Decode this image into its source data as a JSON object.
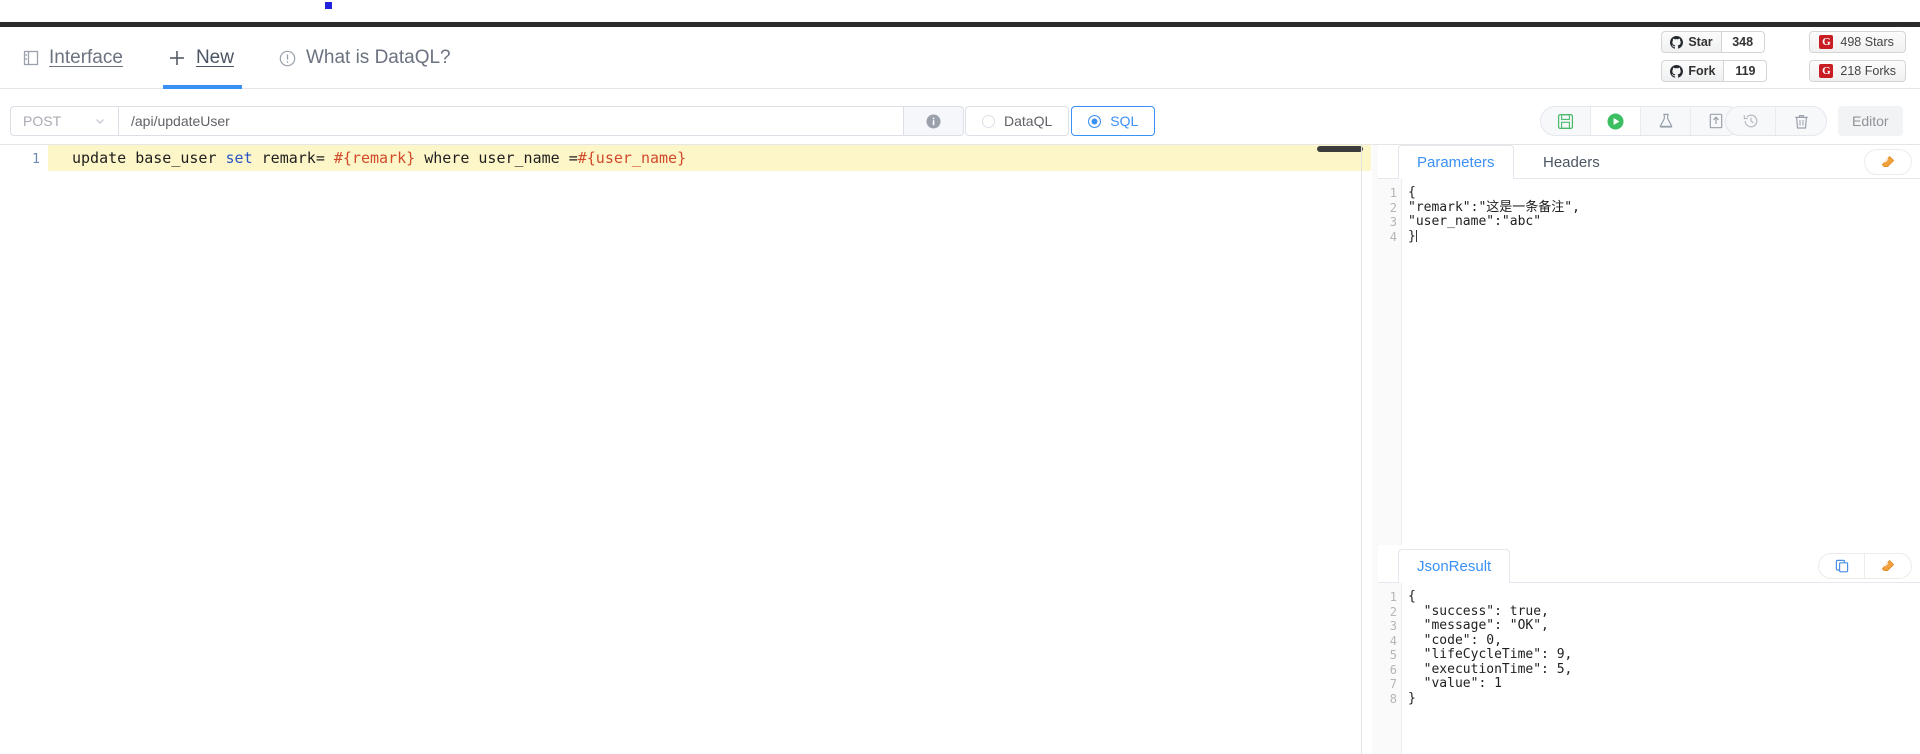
{
  "header": {
    "nav": [
      {
        "id": "interface",
        "icon": "book-icon",
        "label": "Interface"
      },
      {
        "id": "new",
        "icon": "plus-icon",
        "label": "New"
      },
      {
        "id": "what-is-dataql",
        "icon": "info-circle-icon",
        "label": "What is DataQL?"
      }
    ],
    "badges": {
      "github": [
        {
          "icon": "github-mark-icon",
          "label": "Star",
          "count": "348"
        },
        {
          "icon": "github-mark-icon",
          "label": "Fork",
          "count": "119"
        }
      ],
      "gitee": [
        {
          "icon": "gitee-logo-icon",
          "mark": "G",
          "label": "498 Stars"
        },
        {
          "icon": "gitee-logo-icon",
          "mark": "G",
          "label": "218 Forks"
        }
      ]
    }
  },
  "toolbar": {
    "method": "POST",
    "method_caret": "chevron-down-icon",
    "path_value": "/api/updateUser",
    "path_placeholder": "/api/path",
    "info_icon": "info-icon",
    "languages": [
      {
        "id": "dataql",
        "label": "DataQL",
        "selected": false
      },
      {
        "id": "sql",
        "label": "SQL",
        "selected": true
      }
    ],
    "actions_left": [
      {
        "id": "save",
        "icon": "save-icon",
        "title": "Save"
      },
      {
        "id": "run",
        "icon": "run-icon",
        "title": "Run"
      },
      {
        "id": "test",
        "icon": "flask-icon",
        "title": "Test"
      },
      {
        "id": "publish",
        "icon": "upload-icon",
        "title": "Publish"
      }
    ],
    "actions_right": [
      {
        "id": "history",
        "icon": "history-icon",
        "title": "History"
      },
      {
        "id": "delete",
        "icon": "trash-icon",
        "title": "Delete"
      }
    ],
    "editor_label": "Editor"
  },
  "sql_editor": {
    "line_number": "1",
    "tokens": [
      {
        "t": "update base_user ",
        "k": "plain"
      },
      {
        "t": "set",
        "k": "kw"
      },
      {
        "t": " remark= ",
        "k": "plain"
      },
      {
        "t": "#{remark}",
        "k": "var"
      },
      {
        "t": " where user_name =",
        "k": "plain"
      },
      {
        "t": "#{user_name}",
        "k": "var"
      }
    ],
    "plain_text": "update base_user set remark= #{remark} where user_name =#{user_name}"
  },
  "params_panel": {
    "tabs": [
      {
        "id": "parameters",
        "label": "Parameters",
        "active": true
      },
      {
        "id": "headers",
        "label": "Headers",
        "active": false
      }
    ],
    "buttons": [
      {
        "id": "format",
        "icon": "eraser-icon",
        "title": "Format"
      }
    ],
    "line_numbers": [
      "1",
      "2",
      "3",
      "4"
    ],
    "lines": [
      "{",
      "\"remark\":\"这是一条备注\",",
      "\"user_name\":\"abc\"",
      "}"
    ]
  },
  "result_panel": {
    "tabs": [
      {
        "id": "jsonresult",
        "label": "JsonResult",
        "active": true
      }
    ],
    "buttons": [
      {
        "id": "copy",
        "icon": "copy-icon",
        "title": "Copy"
      },
      {
        "id": "format",
        "icon": "eraser-icon",
        "title": "Format"
      }
    ],
    "line_numbers": [
      "1",
      "2",
      "3",
      "4",
      "5",
      "6",
      "7",
      "8"
    ],
    "lines": [
      "{",
      "  \"success\": true,",
      "  \"message\": \"OK\",",
      "  \"code\": 0,",
      "  \"lifeCycleTime\": 9,",
      "  \"executionTime\": 5,",
      "  \"value\": 1",
      "}"
    ]
  },
  "colors": {
    "accent_blue": "#3b90f5",
    "run_green": "#4cb96b",
    "gitee_red": "#c71d23",
    "highlight_yellow": "#fdf6c8",
    "keyword_blue": "#2b55c4",
    "variable_red": "#d04a2b"
  }
}
